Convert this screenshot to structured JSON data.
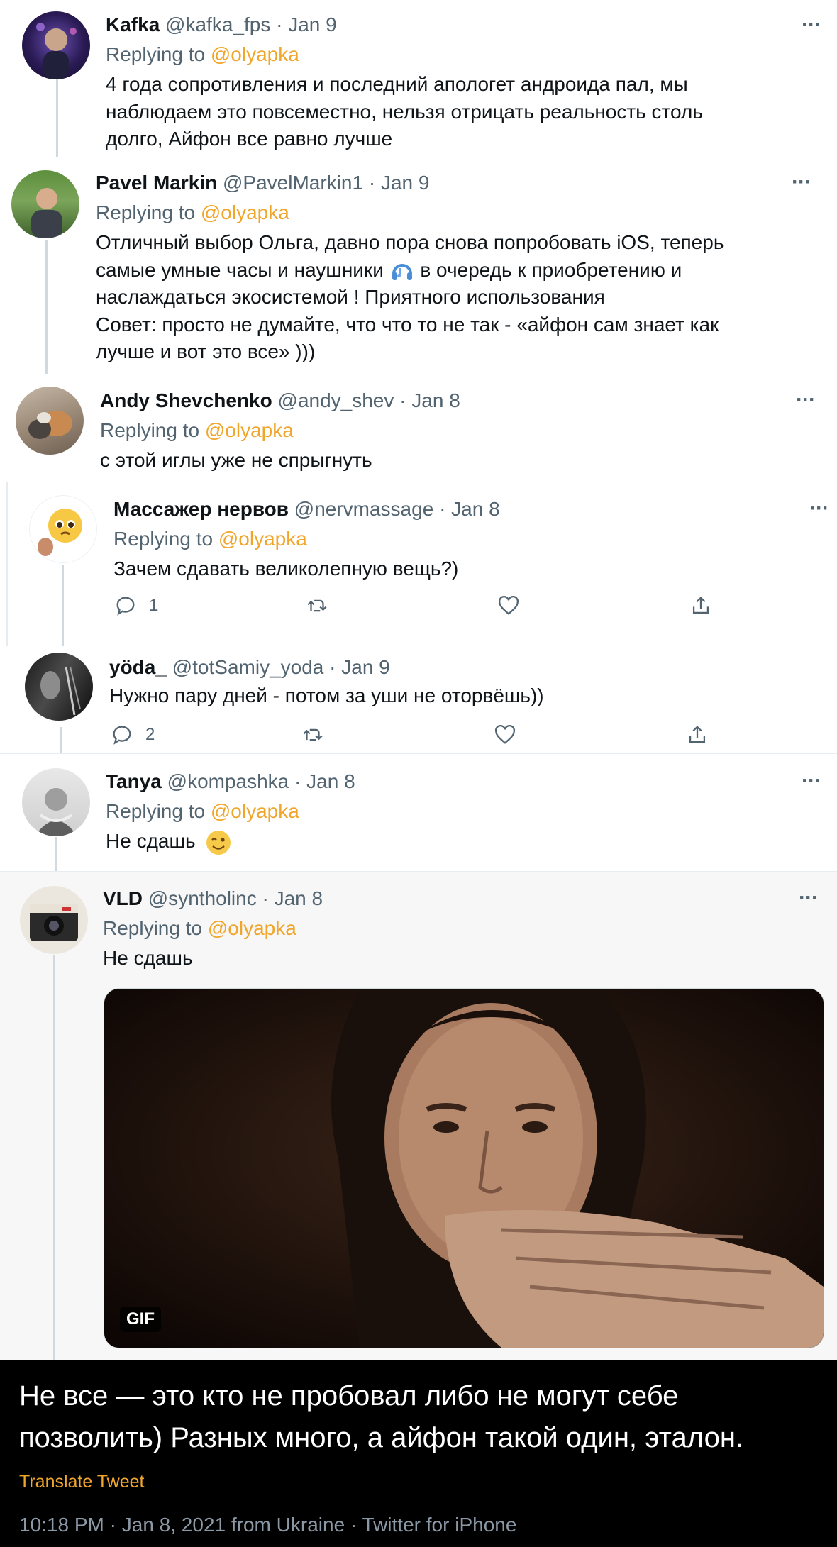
{
  "colors": {
    "accent": "#f0a62b",
    "meta": "#536471",
    "text": "#0f1419",
    "highlight_bg": "#f7f7f7"
  },
  "tweets": [
    {
      "name": "Kafka",
      "handle": "@kafka_fps",
      "date": "Jan 9",
      "replying_label": "Replying to",
      "replying_to": "@olyapka",
      "lines": [
        "4 года сопротивления и последний апологет андроида пал, мы",
        "наблюдаем это повсеместно, нельзя отрицать реальность столь",
        "долго, Айфон все равно лучше"
      ]
    },
    {
      "name": "Pavel Markin",
      "handle": "@PavelMarkin1",
      "date": "Jan 9",
      "replying_label": "Replying to",
      "replying_to": "@olyapka",
      "line1": "Отличный выбор Ольга, давно пора снова попробовать iOS, теперь",
      "line2_a": "самые умные часы и наушники",
      "line2_b": "в очередь к приобретению и",
      "line3": "наслаждаться экосистемой ! Приятного использования",
      "line4": "Совет: просто не думайте, что что то не так - «айфон сам знает как",
      "line5": "лучше и вот это все» )))"
    },
    {
      "name": "Andy Shevchenko",
      "handle": "@andy_shev",
      "date": "Jan 8",
      "replying_label": "Replying to",
      "replying_to": "@olyapka",
      "text": "с этой иглы уже не спрыгнуть"
    },
    {
      "name": "Массажер нервов",
      "handle": "@nervmassage",
      "date": "Jan 8",
      "replying_label": "Replying to",
      "replying_to": "@olyapka",
      "text": "Зачем сдавать великолепную вещь?)",
      "reply_count": "1"
    },
    {
      "name": "yöda_",
      "handle": "@totSamiy_yoda",
      "date": "Jan 9",
      "text": "Нужно пару дней - потом за уши не оторвёшь))",
      "reply_count": "2"
    },
    {
      "name": "Tanya",
      "handle": "@kompashka",
      "date": "Jan 8",
      "replying_label": "Replying to",
      "replying_to": "@olyapka",
      "text": "Не сдашь"
    },
    {
      "name": "VLD",
      "handle": "@syntholinc",
      "date": "Jan 8",
      "replying_label": "Replying to",
      "replying_to": "@olyapka",
      "text": "Не сдашь",
      "gif_badge": "GIF"
    }
  ],
  "separator": "·",
  "more_label": "···",
  "main_tweet": {
    "line1": "Не все — это кто не пробовал либо не могут себе",
    "line2": "позволить) Разных много, а айфон такой один, эталон.",
    "translate": "Translate Tweet",
    "time": "10:18 PM",
    "date": "Jan 8, 2021",
    "from": "from Ukraine",
    "client": "Twitter for iPhone"
  }
}
